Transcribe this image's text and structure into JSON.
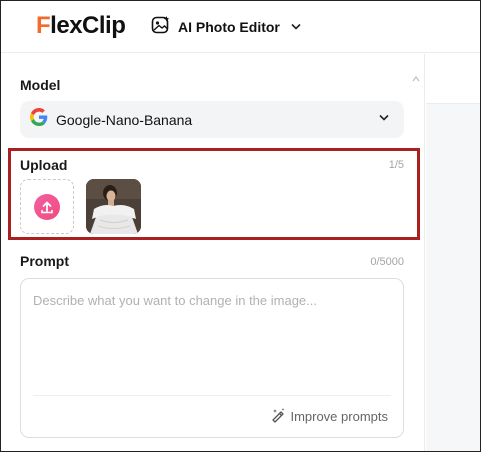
{
  "header": {
    "logo_f": "F",
    "logo_lex": "lex",
    "logo_clip": "Clip",
    "tool_label": "AI Photo Editor"
  },
  "model": {
    "title": "Model",
    "selected": "Google-Nano-Banana"
  },
  "upload": {
    "title": "Upload",
    "count": "1/5"
  },
  "prompt": {
    "title": "Prompt",
    "count": "0/5000",
    "placeholder": "Describe what you want to change in the image...",
    "value": "",
    "improve_label": "Improve prompts"
  },
  "colors": {
    "brand_orange": "#f26a2e",
    "upload_pink": "#f04c7e",
    "highlight_red": "#a8201f"
  },
  "icons": [
    "ai-photo-editor-icon",
    "chevron-down-icon",
    "google-icon",
    "upload-icon",
    "improve-prompts-icon",
    "scroll-up-icon"
  ]
}
